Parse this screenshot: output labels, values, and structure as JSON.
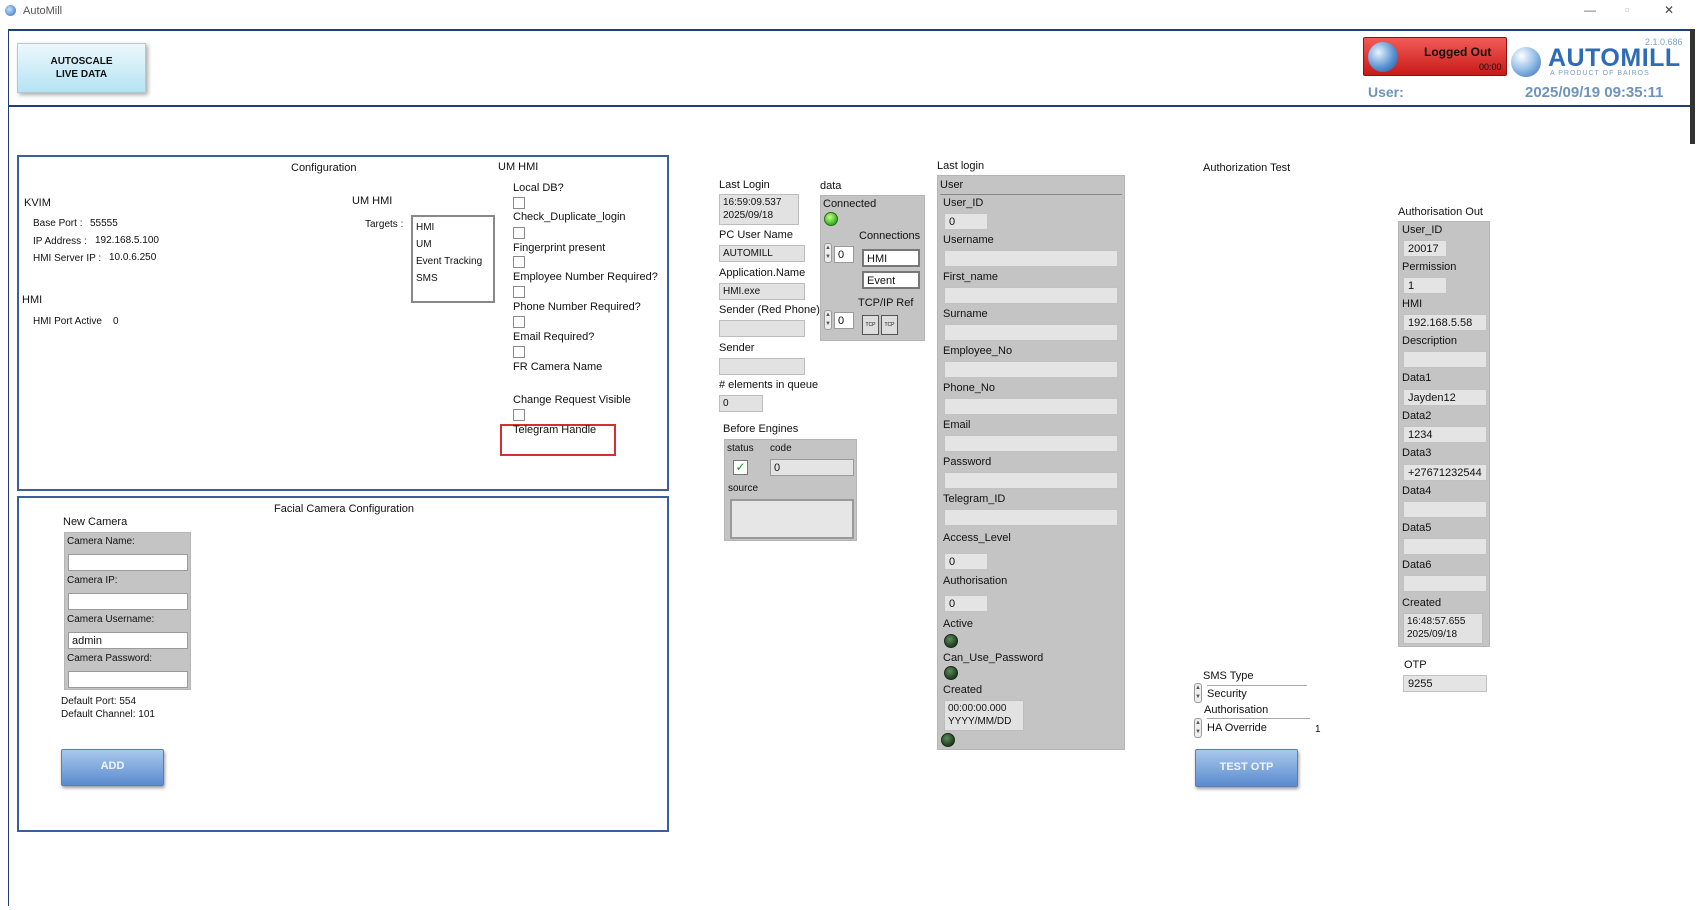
{
  "window": {
    "title": "AutoMill",
    "minimize": "—",
    "restore": "▫",
    "close": "✕"
  },
  "header": {
    "autoscale_line1": "AUTOSCALE",
    "autoscale_line2": "LIVE DATA",
    "logged_out": "Logged Out",
    "logged_timer": "00:00",
    "version": "2.1.0.686",
    "logo_text": "AUTOMILL",
    "logo_sub": "A PRODUCT OF BAIROS",
    "user_label": "User:",
    "datetime": "2025/09/19 09:35:11"
  },
  "config": {
    "title": "Configuration",
    "kvim": "KVIM",
    "base_port_label": "Base Port :",
    "base_port": "55555",
    "ip_label": "IP Address :",
    "ip": "192.168.5.100",
    "hmi_server_label": "HMI Server IP :",
    "hmi_server": "10.0.6.250",
    "hmi": "HMI",
    "hmi_port_label": "HMI Port Active",
    "hmi_port": "0",
    "um_hmi_inner": "UM HMI",
    "targets_label": "Targets :",
    "targets": [
      "HMI",
      "UM",
      "Event Tracking",
      "SMS"
    ],
    "um_hmi_title": "UM HMI",
    "local_db": "Local DB?",
    "check_dup": "Check_Duplicate_login",
    "fingerprint": "Fingerprint present",
    "employee_req": "Employee Number Required?",
    "phone_req": "Phone Number Required?",
    "email_req": "Email Required?",
    "fr_camera": "FR Camera Name",
    "change_req": "Change Request Visible",
    "telegram": "Telegram Handle"
  },
  "facial": {
    "title": "Facial Camera Configuration",
    "new_camera": "New Camera",
    "camera_name": "Camera Name:",
    "camera_ip": "Camera IP:",
    "camera_username": "Camera Username:",
    "camera_username_value": "admin",
    "camera_password": "Camera Password:",
    "default_port": "Default Port: 554",
    "default_channel": "Default Channel: 101",
    "add": "ADD"
  },
  "middle": {
    "last_login": "Last Login",
    "last_login_time": "16:59:09.537",
    "last_login_date": "2025/09/18",
    "pc_user": "PC User Name",
    "pc_user_value": "AUTOMILL",
    "app_name": "Application.Name",
    "app_name_value": "HMI.exe",
    "sender_red": "Sender (Red Phone)",
    "sender": "Sender",
    "elements": "# elements in queue",
    "elements_value": "0",
    "data": "data",
    "connected": "Connected",
    "connections": "Connections",
    "connections_value": "0",
    "conn_hmi": "HMI",
    "conn_event": "Event",
    "tcpip": "TCP/IP Ref",
    "tcpip_value": "0",
    "before_engines": "Before Engines",
    "status": "status",
    "code": "code",
    "code_value": "0",
    "source": "source"
  },
  "user": {
    "last_login": "Last login",
    "user": "User",
    "user_id": "User_ID",
    "user_id_value": "0",
    "username": "Username",
    "first_name": "First_name",
    "surname": "Surname",
    "employee_no": "Employee_No",
    "phone_no": "Phone_No",
    "email": "Email",
    "password": "Password",
    "telegram_id": "Telegram_ID",
    "access_level": "Access_Level",
    "access_level_value": "0",
    "authorisation": "Authorisation",
    "authorisation_value": "0",
    "active": "Active",
    "can_use_password": "Can_Use_Password",
    "created": "Created",
    "created_time": "00:00:00.000",
    "created_date": "YYYY/MM/DD"
  },
  "auth": {
    "title": "Authorization Test",
    "out_title": "Authorisation Out",
    "user_id": "User_ID",
    "user_id_value": "20017",
    "permission": "Permission",
    "permission_value": "1",
    "hmi": "HMI",
    "hmi_value": "192.168.5.58",
    "description": "Description",
    "data1": "Data1",
    "data1_value": "Jayden12",
    "data2": "Data2",
    "data2_value": "1234",
    "data3": "Data3",
    "data3_value": "+27671232544",
    "data4": "Data4",
    "data5": "Data5",
    "data6": "Data6",
    "created": "Created",
    "created_time": "16:48:57.655",
    "created_date": "2025/09/18",
    "otp": "OTP",
    "otp_value": "9255",
    "sms_type": "SMS Type",
    "sms_security": "Security",
    "sms_authorisation": "Authorisation",
    "ha_override": "HA Override",
    "ha_value": "1",
    "test_otp": "TEST OTP"
  }
}
